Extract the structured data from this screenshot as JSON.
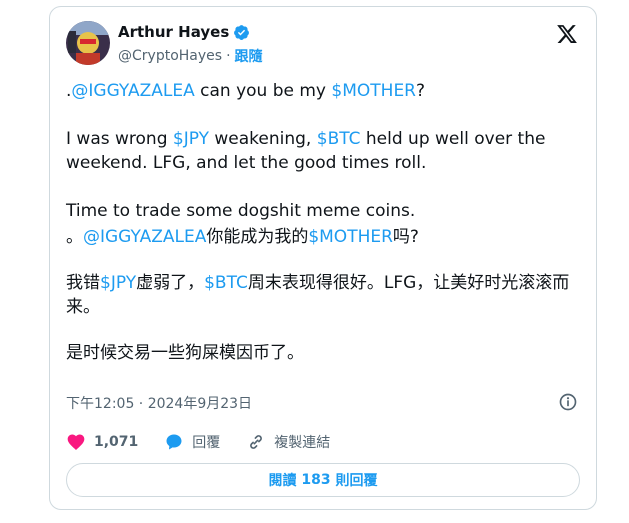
{
  "author": {
    "name": "Arthur Hayes",
    "handle": "@CryptoHayes",
    "separator": "·",
    "follow_label": "跟隨"
  },
  "tweet": {
    "line1": {
      "prefix": ".",
      "mention": "@IGGYAZALEA",
      "middle": " can you be my ",
      "cashtag": "$MOTHER",
      "suffix": "?"
    },
    "line2": {
      "a": "I was wrong ",
      "jpy": "$JPY",
      "b": " weakening, ",
      "btc": "$BTC",
      "c": " held up well over the weekend. LFG, and let the good times roll."
    },
    "line3": "Time to trade some dogshit meme coins.",
    "line4": {
      "prefix": "。",
      "mention": "@IGGYAZALEA",
      "middle": "你能成为我的",
      "cashtag": "$MOTHER",
      "suffix": "吗?"
    },
    "line5": {
      "a": "我错",
      "jpy": "$JPY",
      "b": "虚弱了，",
      "btc": "$BTC",
      "c": "周末表现得很好。LFG，让美好时光滚滚而来。"
    },
    "line6": "是时候交易一些狗屎模因币了。"
  },
  "timestamp": "下午12:05 · 2024年9月23日",
  "actions": {
    "likes": "1,071",
    "reply_label": "回覆",
    "copy_link_label": "複製連結"
  },
  "read_replies": {
    "prefix": "閱讀",
    "count": "183",
    "suffix": "則回覆"
  },
  "colors": {
    "accent": "#1d9bf0",
    "like": "#f91880",
    "text": "#0f1419",
    "muted": "#536471",
    "border": "#cfd9de"
  }
}
